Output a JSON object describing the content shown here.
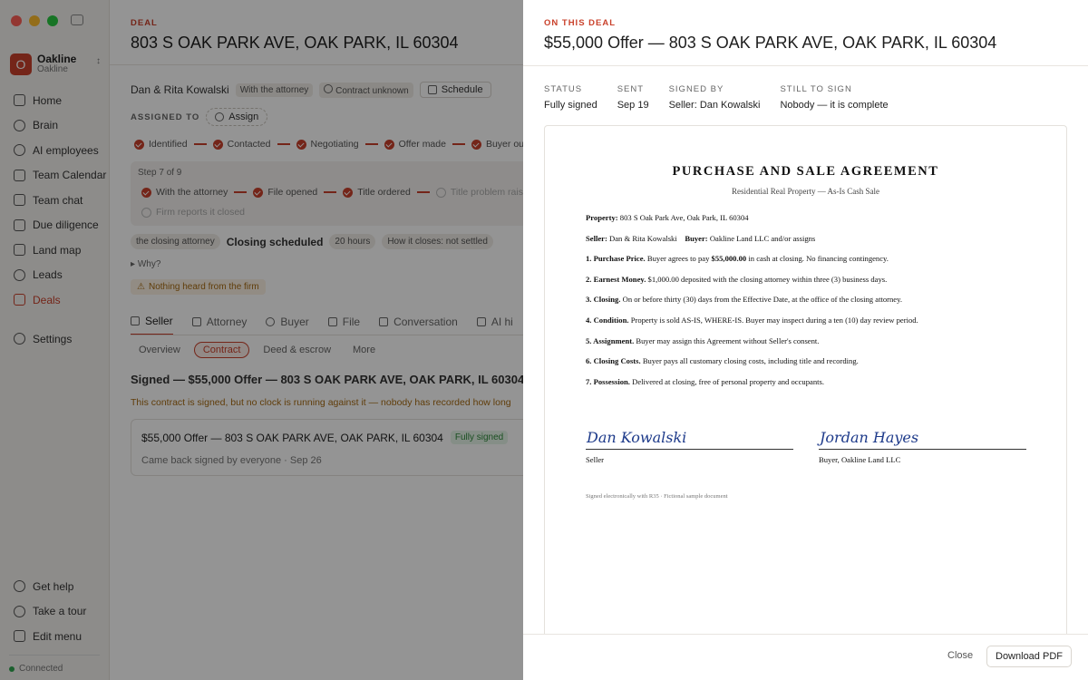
{
  "sidebar": {
    "workspace_initial": "O",
    "workspace_name": "Oakline",
    "workspace_sub": "Oakline",
    "items": [
      {
        "label": "Home"
      },
      {
        "label": "Brain"
      },
      {
        "label": "AI employees"
      },
      {
        "label": "Team Calendar"
      },
      {
        "label": "Team chat"
      },
      {
        "label": "Due diligence"
      },
      {
        "label": "Land map"
      },
      {
        "label": "Leads"
      },
      {
        "label": "Deals"
      }
    ],
    "settings_label": "Settings",
    "bottom_items": [
      {
        "label": "Get help"
      },
      {
        "label": "Take a tour"
      },
      {
        "label": "Edit menu"
      }
    ],
    "status": "Connected"
  },
  "deal": {
    "eyebrow": "DEAL",
    "title": "803 S OAK PARK AVE, OAK PARK, IL 60304",
    "owner": "Dan & Rita Kowalski",
    "chip_attorney": "With the attorney",
    "chip_contract": "Contract unknown",
    "schedule_label": "Schedule",
    "assigned_label": "ASSIGNED TO",
    "assign_label": "Assign",
    "pipeline": [
      "Identified",
      "Contacted",
      "Negotiating",
      "Offer made",
      "Buyer outre"
    ],
    "step_label": "Step 7 of 9",
    "steps_row1": [
      "With the attorney",
      "File opened",
      "Title ordered",
      "Title problem raised"
    ],
    "steps_row2": [
      "Firm reports it closed"
    ],
    "closing_chip": "the closing attorney",
    "closing_title": "Closing scheduled",
    "closing_hours": "20 hours",
    "closing_how": "How it closes: not settled",
    "why": "Why?",
    "warning": "Nothing heard from the firm",
    "tabs": [
      "Seller",
      "Attorney",
      "Buyer",
      "File",
      "Conversation",
      "AI hi"
    ],
    "subtabs": [
      "Overview",
      "Contract",
      "Deed & escrow",
      "More"
    ],
    "signed_heading": "Signed — $55,000 Offer — 803 S OAK PARK AVE, OAK PARK, IL 60304.",
    "clock_note": "This contract is signed, but no clock is running against it — nobody has recorded how long",
    "card_title": "$55,000 Offer — 803 S OAK PARK AVE, OAK PARK, IL 60304",
    "card_badge": "Fully signed",
    "card_sub": "Came back signed by everyone · Sep 26"
  },
  "drawer": {
    "eyebrow": "ON THIS DEAL",
    "title": "$55,000 Offer — 803 S OAK PARK AVE, OAK PARK, IL 60304",
    "meta": [
      {
        "label": "STATUS",
        "value": "Fully signed"
      },
      {
        "label": "SENT",
        "value": "Sep 19"
      },
      {
        "label": "SIGNED BY",
        "value": "Seller: Dan Kowalski"
      },
      {
        "label": "STILL TO SIGN",
        "value": "Nobody — it is complete"
      }
    ],
    "doc": {
      "title": "PURCHASE AND SALE AGREEMENT",
      "subtitle": "Residential Real Property — As-Is Cash Sale",
      "property_label": "Property:",
      "property_value": "803 S Oak Park Ave, Oak Park, IL 60304",
      "seller_label": "Seller:",
      "seller_value": "Dan & Rita Kowalski",
      "buyer_label": "Buyer:",
      "buyer_value": "Oakline Land LLC and/or assigns",
      "c1_label": "1. Purchase Price.",
      "c1_pre": "Buyer agrees to pay",
      "c1_amount": "$55,000.00",
      "c1_post": "in cash at closing. No financing contingency.",
      "c2_label": "2. Earnest Money.",
      "c2_text": "$1,000.00 deposited with the closing attorney within three (3) business days.",
      "c3_label": "3. Closing.",
      "c3_text": "On or before thirty (30) days from the Effective Date, at the office of the closing attorney.",
      "c4_label": "4. Condition.",
      "c4_text": "Property is sold AS-IS, WHERE-IS. Buyer may inspect during a ten (10) day review period.",
      "c5_label": "5. Assignment.",
      "c5_text": "Buyer may assign this Agreement without Seller's consent.",
      "c6_label": "6. Closing Costs.",
      "c6_text": "Buyer pays all customary closing costs, including title and recording.",
      "c7_label": "7. Possession.",
      "c7_text": "Delivered at closing, free of personal property and occupants.",
      "sig_seller_name": "Dan Kowalski",
      "sig_seller_role": "Seller",
      "sig_buyer_name": "Jordan Hayes",
      "sig_buyer_role": "Buyer, Oakline Land LLC",
      "footer": "Signed electronically with R35 · Fictional sample document"
    },
    "close_label": "Close",
    "download_label": "Download PDF"
  }
}
